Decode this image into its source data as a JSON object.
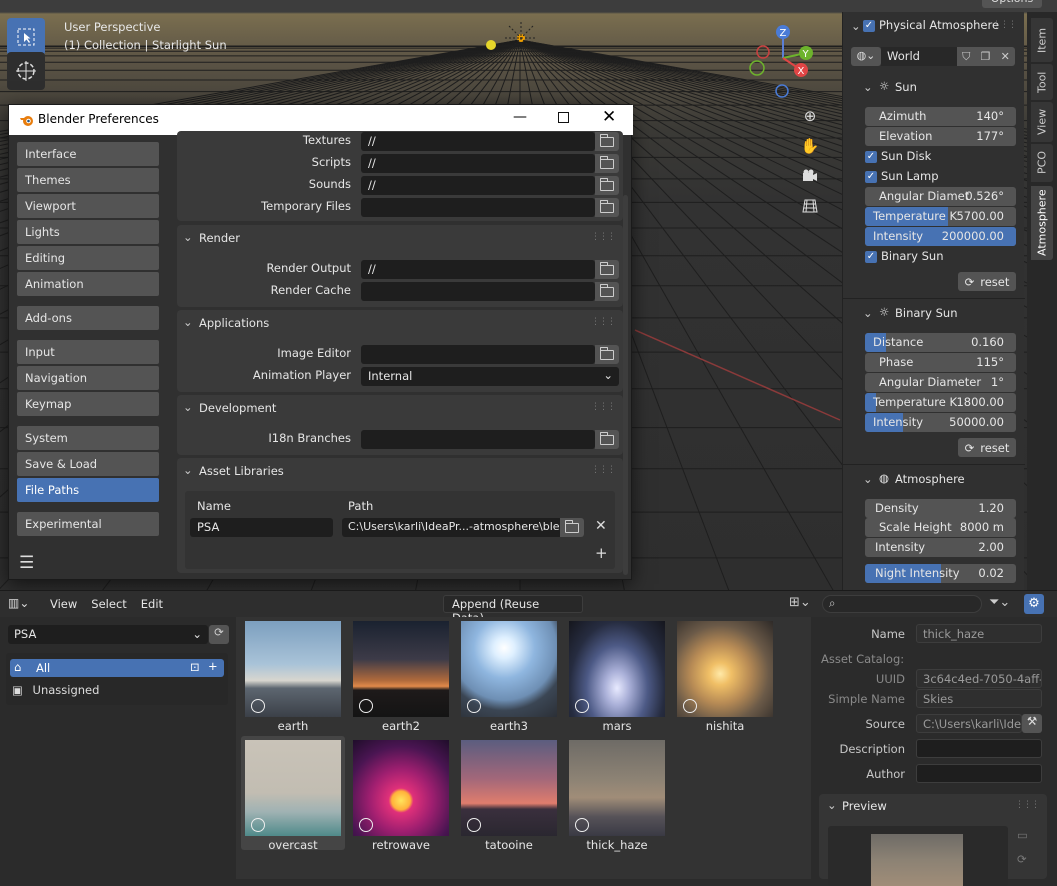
{
  "viewport": {
    "perspective_label": "User Perspective",
    "collection_label": "(1) Collection | Starlight Sun",
    "options_label": "Options",
    "gizmo": {
      "z": "Z",
      "y": "Y",
      "x": "X"
    }
  },
  "npanel": {
    "panel_title": "Physical Atmosphere",
    "world_name": "World",
    "sun": {
      "header": "Sun",
      "azimuth": {
        "label": "Azimuth",
        "value": "140°"
      },
      "elevation": {
        "label": "Elevation",
        "value": "177°"
      },
      "sun_disk": "Sun Disk",
      "sun_lamp": "Sun Lamp",
      "angular_diameter": {
        "label": "Angular Diamet",
        "value": "0.526°"
      },
      "temperature": {
        "label": "Temperature K",
        "value": "5700.00",
        "fill": 0.55
      },
      "intensity": {
        "label": "Intensity",
        "value": "200000.00",
        "fill": 1.0
      },
      "binary_sun": "Binary Sun",
      "reset": "reset"
    },
    "binary_sun": {
      "header": "Binary Sun",
      "distance": {
        "label": "Distance",
        "value": "0.160",
        "fill": 0.14
      },
      "phase": {
        "label": "Phase",
        "value": "115°"
      },
      "angular_diameter": {
        "label": "Angular Diameter",
        "value": "1°"
      },
      "temperature": {
        "label": "Temperature K",
        "value": "1800.00",
        "fill": 0.07
      },
      "intensity": {
        "label": "Intensity",
        "value": "50000.00",
        "fill": 0.25
      },
      "reset": "reset"
    },
    "atmosphere": {
      "header": "Atmosphere",
      "density": {
        "label": "Density",
        "value": "1.20"
      },
      "scale_height": {
        "label": "Scale Height",
        "value": "8000 m"
      },
      "intensity": {
        "label": "Intensity",
        "value": "2.00"
      },
      "night_intensity": {
        "label": "Night Intensity",
        "value": "0.02",
        "fill": 0.5
      }
    },
    "tabs": [
      "Item",
      "Tool",
      "View",
      "PCO",
      "Atmosphere"
    ]
  },
  "prefs": {
    "title": "Blender Preferences",
    "nav": [
      [
        "Interface",
        "Themes",
        "Viewport",
        "Lights",
        "Editing",
        "Animation"
      ],
      [
        "Add-ons"
      ],
      [
        "Input",
        "Navigation",
        "Keymap"
      ],
      [
        "System",
        "Save & Load",
        "File Paths"
      ],
      [
        "Experimental"
      ]
    ],
    "active_nav": "File Paths",
    "data_paths": [
      {
        "label": "Textures",
        "value": "//"
      },
      {
        "label": "Scripts",
        "value": "//"
      },
      {
        "label": "Sounds",
        "value": "//"
      },
      {
        "label": "Temporary Files",
        "value": ""
      }
    ],
    "render": {
      "header": "Render",
      "output_label": "Render Output",
      "output_value": "//",
      "cache_label": "Render Cache",
      "cache_value": ""
    },
    "applications": {
      "header": "Applications",
      "image_editor_label": "Image Editor",
      "image_editor_value": "",
      "anim_player_label": "Animation Player",
      "anim_player_value": "Internal"
    },
    "development": {
      "header": "Development",
      "i18n_label": "I18n Branches",
      "i18n_value": ""
    },
    "asset_libraries": {
      "header": "Asset Libraries",
      "col_name": "Name",
      "col_path": "Path",
      "rows": [
        {
          "name": "PSA",
          "path": "C:\\Users\\karli\\IdeaPr...-atmosphere\\blends\\"
        }
      ]
    }
  },
  "filebrowser": {
    "menus": [
      "View",
      "Select",
      "Edit"
    ],
    "import_method": "Append (Reuse Data)",
    "library": "PSA",
    "catalogs": [
      "All",
      "Unassigned"
    ],
    "assets": [
      {
        "name": "earth",
        "bg": "linear-gradient(#7c9fbf 0%,#a9c3d8 45%,#d8d6cf 62%,#5d6670 70%,#3b4048 100%)"
      },
      {
        "name": "earth2",
        "bg": "linear-gradient(#1a2230 0%,#3d3b48 40%,#b06a3c 62%,#e0894a 68%,#1e1a1a 72%,#141414 100%)"
      },
      {
        "name": "earth3",
        "bg": "radial-gradient(circle at 45% 28%,#ffffff 0%,#dff0ff 12%,#8fb6df 35%,#6e8fb4 60%,#3b4654 72%,#2b2f36 100%)"
      },
      {
        "name": "mars",
        "bg": "radial-gradient(ellipse at 50% 70%,#e8eaff 0%,#aab0d8 18%,#4d5a86 45%,#262c40 70%,#15161d 100%)"
      },
      {
        "name": "nishita",
        "bg": "radial-gradient(circle at 45% 55%,#ffe9a8 0%,#f0bf66 15%,#b68a55 40%,#6b5a48 65%,#2e2a28 100%)"
      },
      {
        "name": "overcast",
        "bg": "linear-gradient(#c9c3b8 0%,#c2bdb2 55%,#9fb2b3 75%,#4f8a8a 100%)"
      },
      {
        "name": "retrowave",
        "bg": "radial-gradient(circle at 50% 63%,#ffe45c 0%,#ffb13b 12%,#e0307a 16%,#a01f70 40%,#4a1552 70%,#1f0d2a 100%)"
      },
      {
        "name": "tatooine",
        "bg": "linear-gradient(#5b5d7f 0%,#a2677a 40%,#e07d6d 66%,#3a2f3d 72%,#2a2730 100%)"
      },
      {
        "name": "thick_haze",
        "bg": "linear-gradient(#6e6b66 0%,#8c8274 40%,#a08d78 60%,#565258 80%,#3a3a44 100%)"
      }
    ],
    "props": {
      "name_label": "Name",
      "name_value": "thick_haze",
      "asset_catalog_label": "Asset Catalog:",
      "uuid_label": "UUID",
      "uuid_value": "3c64c4ed-7050-4aff-...",
      "simple_name_label": "Simple Name",
      "simple_name_value": "Skies",
      "source_label": "Source",
      "source_value": "C:\\Users\\karli\\Idea...",
      "description_label": "Description",
      "description_value": "",
      "author_label": "Author",
      "author_value": "",
      "preview_header": "Preview"
    }
  }
}
